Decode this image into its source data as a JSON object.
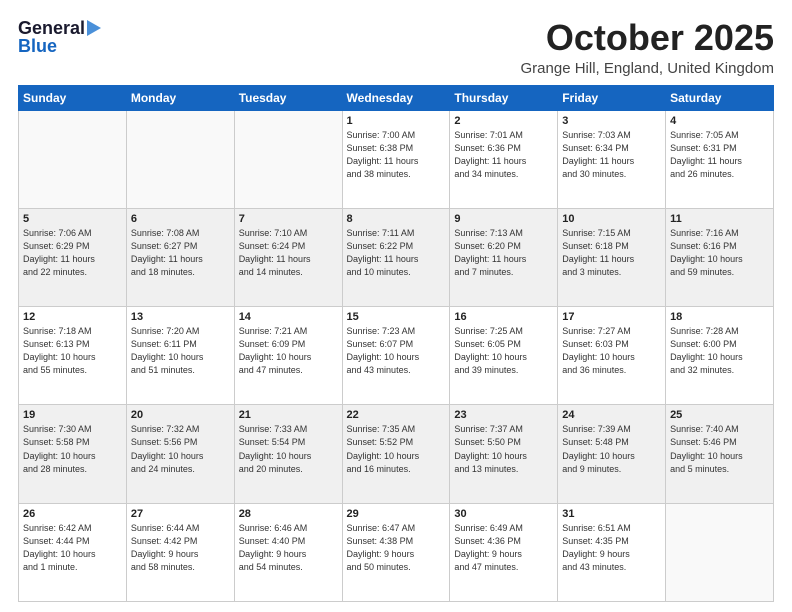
{
  "logo": {
    "top": "General",
    "arrow": "▶",
    "bottom": "Blue"
  },
  "title": "October 2025",
  "location": "Grange Hill, England, United Kingdom",
  "weekdays": [
    "Sunday",
    "Monday",
    "Tuesday",
    "Wednesday",
    "Thursday",
    "Friday",
    "Saturday"
  ],
  "weeks": [
    [
      {
        "day": "",
        "info": ""
      },
      {
        "day": "",
        "info": ""
      },
      {
        "day": "",
        "info": ""
      },
      {
        "day": "1",
        "info": "Sunrise: 7:00 AM\nSunset: 6:38 PM\nDaylight: 11 hours\nand 38 minutes."
      },
      {
        "day": "2",
        "info": "Sunrise: 7:01 AM\nSunset: 6:36 PM\nDaylight: 11 hours\nand 34 minutes."
      },
      {
        "day": "3",
        "info": "Sunrise: 7:03 AM\nSunset: 6:34 PM\nDaylight: 11 hours\nand 30 minutes."
      },
      {
        "day": "4",
        "info": "Sunrise: 7:05 AM\nSunset: 6:31 PM\nDaylight: 11 hours\nand 26 minutes."
      }
    ],
    [
      {
        "day": "5",
        "info": "Sunrise: 7:06 AM\nSunset: 6:29 PM\nDaylight: 11 hours\nand 22 minutes."
      },
      {
        "day": "6",
        "info": "Sunrise: 7:08 AM\nSunset: 6:27 PM\nDaylight: 11 hours\nand 18 minutes."
      },
      {
        "day": "7",
        "info": "Sunrise: 7:10 AM\nSunset: 6:24 PM\nDaylight: 11 hours\nand 14 minutes."
      },
      {
        "day": "8",
        "info": "Sunrise: 7:11 AM\nSunset: 6:22 PM\nDaylight: 11 hours\nand 10 minutes."
      },
      {
        "day": "9",
        "info": "Sunrise: 7:13 AM\nSunset: 6:20 PM\nDaylight: 11 hours\nand 7 minutes."
      },
      {
        "day": "10",
        "info": "Sunrise: 7:15 AM\nSunset: 6:18 PM\nDaylight: 11 hours\nand 3 minutes."
      },
      {
        "day": "11",
        "info": "Sunrise: 7:16 AM\nSunset: 6:16 PM\nDaylight: 10 hours\nand 59 minutes."
      }
    ],
    [
      {
        "day": "12",
        "info": "Sunrise: 7:18 AM\nSunset: 6:13 PM\nDaylight: 10 hours\nand 55 minutes."
      },
      {
        "day": "13",
        "info": "Sunrise: 7:20 AM\nSunset: 6:11 PM\nDaylight: 10 hours\nand 51 minutes."
      },
      {
        "day": "14",
        "info": "Sunrise: 7:21 AM\nSunset: 6:09 PM\nDaylight: 10 hours\nand 47 minutes."
      },
      {
        "day": "15",
        "info": "Sunrise: 7:23 AM\nSunset: 6:07 PM\nDaylight: 10 hours\nand 43 minutes."
      },
      {
        "day": "16",
        "info": "Sunrise: 7:25 AM\nSunset: 6:05 PM\nDaylight: 10 hours\nand 39 minutes."
      },
      {
        "day": "17",
        "info": "Sunrise: 7:27 AM\nSunset: 6:03 PM\nDaylight: 10 hours\nand 36 minutes."
      },
      {
        "day": "18",
        "info": "Sunrise: 7:28 AM\nSunset: 6:00 PM\nDaylight: 10 hours\nand 32 minutes."
      }
    ],
    [
      {
        "day": "19",
        "info": "Sunrise: 7:30 AM\nSunset: 5:58 PM\nDaylight: 10 hours\nand 28 minutes."
      },
      {
        "day": "20",
        "info": "Sunrise: 7:32 AM\nSunset: 5:56 PM\nDaylight: 10 hours\nand 24 minutes."
      },
      {
        "day": "21",
        "info": "Sunrise: 7:33 AM\nSunset: 5:54 PM\nDaylight: 10 hours\nand 20 minutes."
      },
      {
        "day": "22",
        "info": "Sunrise: 7:35 AM\nSunset: 5:52 PM\nDaylight: 10 hours\nand 16 minutes."
      },
      {
        "day": "23",
        "info": "Sunrise: 7:37 AM\nSunset: 5:50 PM\nDaylight: 10 hours\nand 13 minutes."
      },
      {
        "day": "24",
        "info": "Sunrise: 7:39 AM\nSunset: 5:48 PM\nDaylight: 10 hours\nand 9 minutes."
      },
      {
        "day": "25",
        "info": "Sunrise: 7:40 AM\nSunset: 5:46 PM\nDaylight: 10 hours\nand 5 minutes."
      }
    ],
    [
      {
        "day": "26",
        "info": "Sunrise: 6:42 AM\nSunset: 4:44 PM\nDaylight: 10 hours\nand 1 minute."
      },
      {
        "day": "27",
        "info": "Sunrise: 6:44 AM\nSunset: 4:42 PM\nDaylight: 9 hours\nand 58 minutes."
      },
      {
        "day": "28",
        "info": "Sunrise: 6:46 AM\nSunset: 4:40 PM\nDaylight: 9 hours\nand 54 minutes."
      },
      {
        "day": "29",
        "info": "Sunrise: 6:47 AM\nSunset: 4:38 PM\nDaylight: 9 hours\nand 50 minutes."
      },
      {
        "day": "30",
        "info": "Sunrise: 6:49 AM\nSunset: 4:36 PM\nDaylight: 9 hours\nand 47 minutes."
      },
      {
        "day": "31",
        "info": "Sunrise: 6:51 AM\nSunset: 4:35 PM\nDaylight: 9 hours\nand 43 minutes."
      },
      {
        "day": "",
        "info": ""
      }
    ]
  ]
}
